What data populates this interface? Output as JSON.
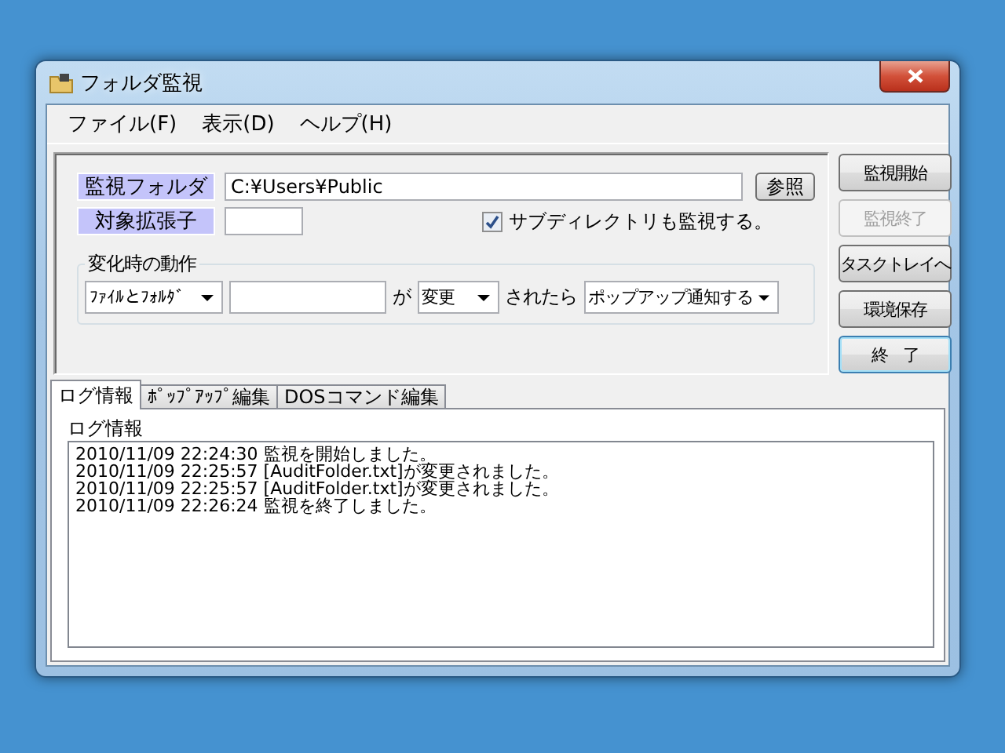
{
  "window": {
    "title": "フォルダ監視"
  },
  "menu": [
    {
      "label": "ファイル(F)"
    },
    {
      "label": "表示(D)"
    },
    {
      "label": "ヘルプ(H)"
    }
  ],
  "form": {
    "folder_label": "監視フォルダ",
    "folder_value": "C:¥Users¥Public",
    "browse_button": "参照",
    "extension_label": "対象拡張子",
    "subdirectories": {
      "label": "サブディレクトリも監視する。",
      "checked": true
    }
  },
  "action_group": {
    "title": "変化時の動作",
    "target": "ﾌｧｲﾙとﾌｫﾙﾀﾞ",
    "particle": "が",
    "change": "変更",
    "condition": "されたら",
    "action": "ポップアップ通知する"
  },
  "buttons": [
    {
      "label": "監視開始",
      "disabled": false,
      "focused": false
    },
    {
      "label": "監視終了",
      "disabled": true,
      "focused": false
    },
    {
      "label": "タスクトレイへ",
      "disabled": false,
      "focused": false
    },
    {
      "label": "環境保存",
      "disabled": false,
      "focused": false
    },
    {
      "label": "終　了",
      "disabled": false,
      "focused": true
    }
  ],
  "tabs": [
    {
      "label": "ログ情報",
      "selected": true
    },
    {
      "label": "ﾎﾟｯﾌﾟｱｯﾌﾟ編集",
      "selected": false
    },
    {
      "label": "DOSコマンド編集",
      "selected": false
    }
  ],
  "log": {
    "title": "ログ情報",
    "lines": [
      "2010/11/09 22:24:30 監視を開始しました。",
      "2010/11/09 22:25:57 [AuditFolder.txt]が変更されました。",
      "2010/11/09 22:25:57 [AuditFolder.txt]が変更されました。",
      "2010/11/09 22:26:24 監視を終了しました。"
    ]
  }
}
